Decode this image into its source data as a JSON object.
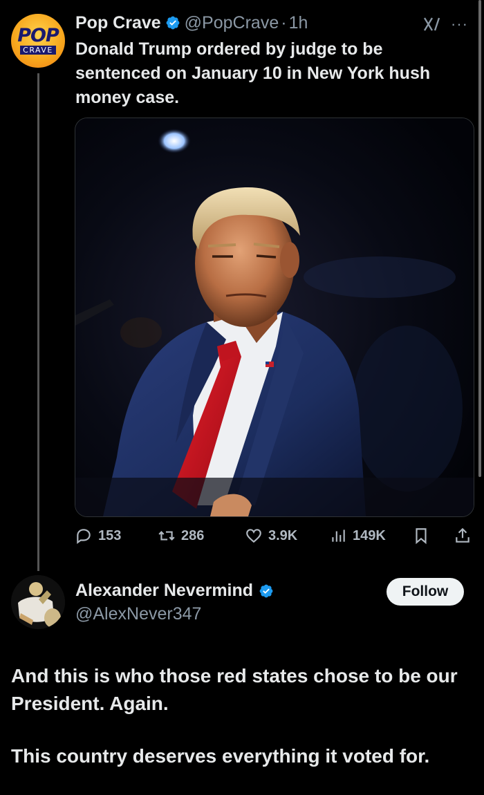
{
  "parent": {
    "author": "Pop Crave",
    "handle": "@PopCrave",
    "time_sep": "·",
    "time": "1h",
    "avatar_text_top": "POP",
    "avatar_text_bottom": "CRAVE",
    "text": "Donald Trump ordered by judge to be sentenced on January 10 in New York hush money case.",
    "stats": {
      "replies": "153",
      "reposts": "286",
      "likes": "3.9K",
      "views": "149K"
    }
  },
  "reply": {
    "author": "Alexander Nevermind",
    "handle": "@AlexNever347",
    "follow_label": "Follow",
    "paragraphs": [
      "And this is who those red states chose to be our President. Again.",
      "This country deserves everything it voted for."
    ]
  },
  "colors": {
    "background": "#000000",
    "verified_blue": "#1d9bf0",
    "muted": "#8b98a5",
    "tie_red": "#d0101c",
    "suit_navy": "#1c2d5e"
  },
  "icons": [
    "verified-icon",
    "grok-icon",
    "more-icon",
    "reply-icon",
    "repost-icon",
    "like-icon",
    "views-icon",
    "bookmark-icon",
    "share-icon"
  ]
}
